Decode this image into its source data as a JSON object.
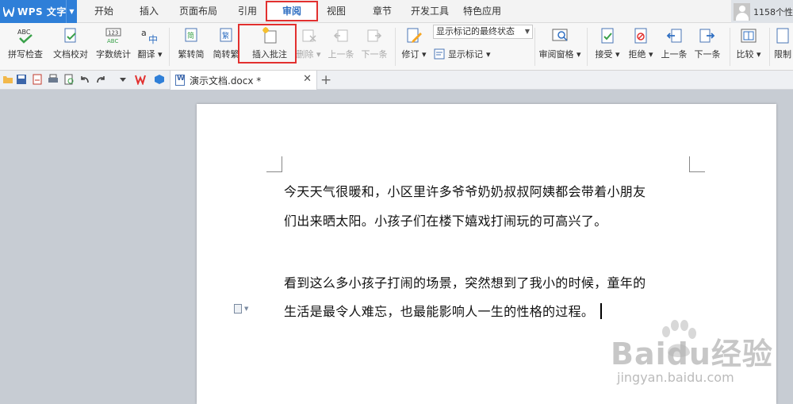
{
  "app": {
    "name": "WPS 文字",
    "user": "1158个性"
  },
  "menu": {
    "tabs": [
      {
        "label": "开始"
      },
      {
        "label": "插入"
      },
      {
        "label": "页面布局"
      },
      {
        "label": "引用"
      },
      {
        "label": "审阅",
        "active": true
      },
      {
        "label": "视图"
      },
      {
        "label": "章节"
      },
      {
        "label": "开发工具"
      },
      {
        "label": "特色应用"
      }
    ]
  },
  "ribbon": {
    "spell_check": "拼写检查",
    "doc_proof": "文档校对",
    "word_count": "字数统计",
    "translate": "翻译",
    "trad_to_simp": "繁转简",
    "simp_to_trad": "简转繁",
    "insert_comment": "插入批注",
    "delete": "删除",
    "prev_comment": "上一条",
    "next_comment": "下一条",
    "track_changes": "修订",
    "markup_state": "显示标记的最终状态",
    "show_markup": "显示标记",
    "review_pane": "审阅窗格",
    "accept": "接受",
    "reject": "拒绝",
    "prev_change": "上一条",
    "next_change": "下一条",
    "compare": "比较",
    "restrict": "限制"
  },
  "tabs_bar": {
    "doc_name": "演示文档.docx *"
  },
  "document": {
    "paragraphs": [
      {
        "lines": [
          "今天天气很暖和，小区里许多爷爷奶奶叔叔阿姨都会带着小朋友",
          "们出来晒太阳。小孩子们在楼下嬉戏打闹玩的可高兴了。"
        ]
      },
      {
        "lines": [
          "看到这么多小孩子打闹的场景，突然想到了我小的时候，童年的",
          "生活是最令人难忘，也最能影响人一生的性格的过程。"
        ]
      }
    ]
  },
  "watermark": {
    "main": "Baidu经验",
    "sub": "jingyan.baidu.com"
  },
  "colors": {
    "accent": "#2f7fd8",
    "highlight": "#e2302f"
  }
}
